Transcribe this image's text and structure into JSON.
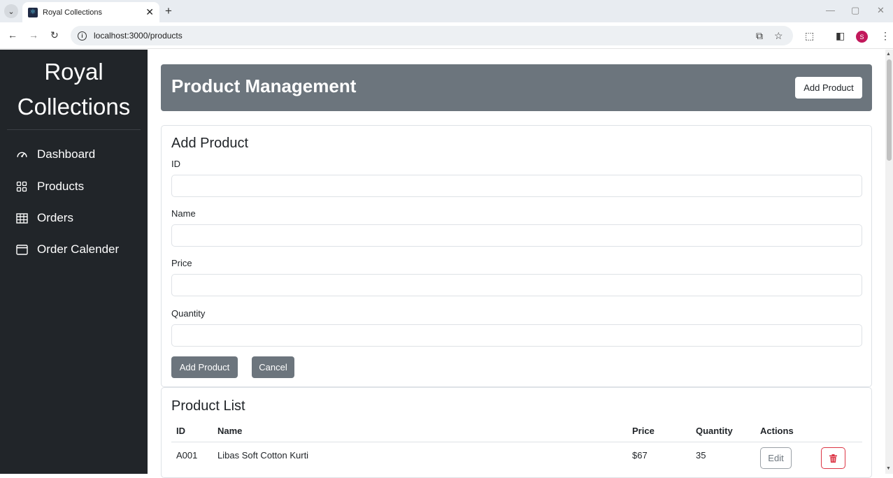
{
  "browser": {
    "tab_title": "Royal Collections",
    "url": "localhost:3000/products",
    "avatar_initial": "S"
  },
  "sidebar": {
    "brand_line1": "Royal",
    "brand_line2": "Collections",
    "items": [
      {
        "label": "Dashboard",
        "icon": "speedometer-icon"
      },
      {
        "label": "Products",
        "icon": "grid-icon"
      },
      {
        "label": "Orders",
        "icon": "table-icon"
      },
      {
        "label": "Order Calender",
        "icon": "calendar-icon"
      }
    ]
  },
  "header": {
    "title": "Product Management",
    "add_button": "Add Product"
  },
  "form": {
    "title": "Add Product",
    "fields": [
      {
        "label": "ID",
        "value": ""
      },
      {
        "label": "Name",
        "value": ""
      },
      {
        "label": "Price",
        "value": ""
      },
      {
        "label": "Quantity",
        "value": ""
      }
    ],
    "submit_label": "Add Product",
    "cancel_label": "Cancel"
  },
  "product_list": {
    "title": "Product List",
    "columns": [
      "ID",
      "Name",
      "Price",
      "Quantity",
      "Actions"
    ],
    "rows": [
      {
        "id": "A001",
        "name": "Libas Soft Cotton Kurti",
        "price": "$67",
        "quantity": "35",
        "edit_label": "Edit"
      }
    ]
  },
  "colors": {
    "sidebar_bg": "#212529",
    "header_bg": "#6c757d",
    "secondary_btn": "#6c757d",
    "danger": "#dc3545"
  }
}
